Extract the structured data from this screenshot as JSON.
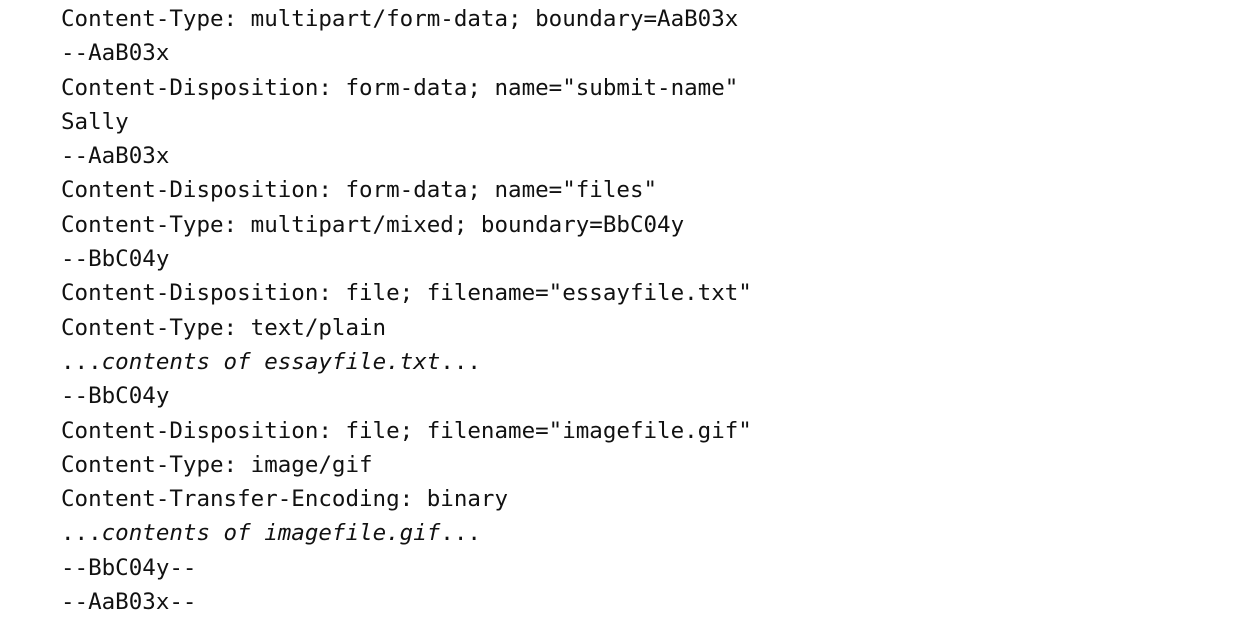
{
  "lines": [
    {
      "text": "Content-Type: multipart/form-data; boundary=AaB03x"
    },
    {
      "text": "--AaB03x"
    },
    {
      "text": "Content-Disposition: form-data; name=\"submit-name\""
    },
    {
      "text": "Sally"
    },
    {
      "text": "--AaB03x"
    },
    {
      "text": "Content-Disposition: form-data; name=\"files\""
    },
    {
      "text": "Content-Type: multipart/mixed; boundary=BbC04y"
    },
    {
      "text": "--BbC04y"
    },
    {
      "text": "Content-Disposition: file; filename=\"essayfile.txt\""
    },
    {
      "text": "Content-Type: text/plain"
    },
    {
      "prefix": "...",
      "italic": "contents of essayfile.txt",
      "suffix": "..."
    },
    {
      "text": "--BbC04y"
    },
    {
      "text": "Content-Disposition: file; filename=\"imagefile.gif\""
    },
    {
      "text": "Content-Type: image/gif"
    },
    {
      "text": "Content-Transfer-Encoding: binary"
    },
    {
      "prefix": "...",
      "italic": "contents of imagefile.gif",
      "suffix": "..."
    },
    {
      "text": "--BbC04y--"
    },
    {
      "text": "--AaB03x--"
    }
  ]
}
